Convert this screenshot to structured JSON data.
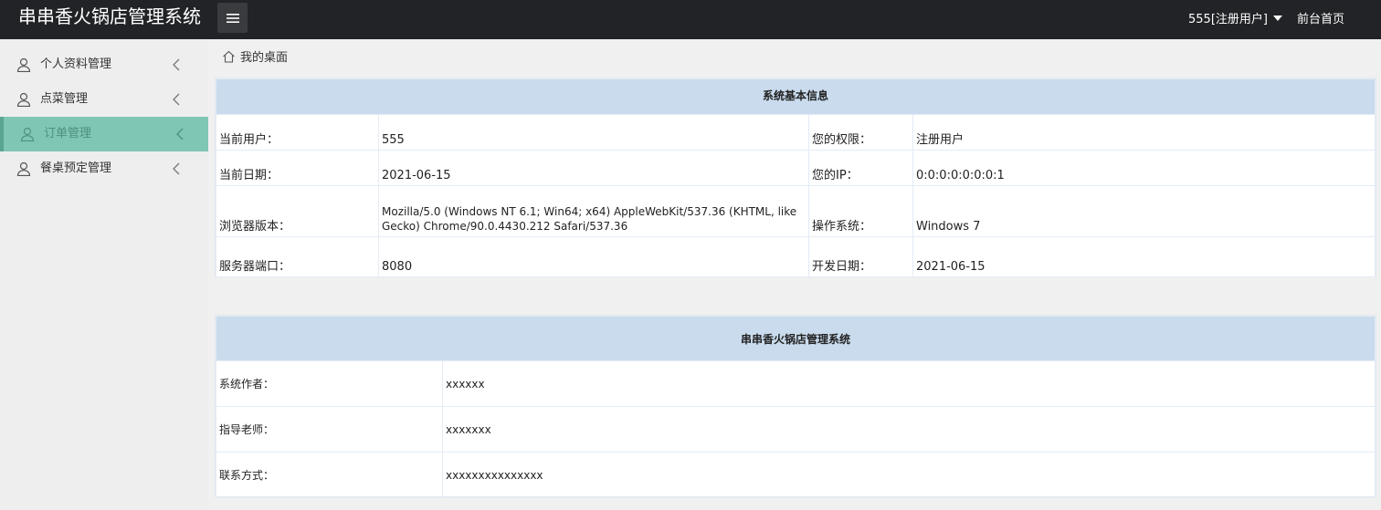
{
  "header": {
    "app_title": "串串香火锅店管理系统",
    "menu_toggle_icon": "hamburger-icon",
    "user_label": "555[注册用户]",
    "home_link": "前台首页"
  },
  "sidebar": {
    "items": [
      {
        "label": "个人资料管理",
        "icon": "user-icon",
        "active": false
      },
      {
        "label": "点菜管理",
        "icon": "user-icon",
        "active": false
      },
      {
        "label": "订单管理",
        "icon": "user-icon",
        "active": true
      },
      {
        "label": "餐桌预定管理",
        "icon": "user-icon",
        "active": false
      }
    ]
  },
  "breadcrumb": {
    "icon": "home-icon",
    "label": "我的桌面"
  },
  "system_info": {
    "title": "系统基本信息",
    "rows": [
      {
        "l1": "当前用户：",
        "v1": "555",
        "l2": "您的权限：",
        "v2": "注册用户"
      },
      {
        "l1": "当前日期：",
        "v1": "2021-06-15",
        "l2": "您的IP：",
        "v2": "0:0:0:0:0:0:0:1"
      },
      {
        "l1": "浏览器版本：",
        "v1": "Mozilla/5.0 (Windows NT 6.1; Win64; x64) AppleWebKit/537.36 (KHTML, like Gecko) Chrome/90.0.4430.212 Safari/537.36",
        "l2": "操作系统：",
        "v2": "Windows 7"
      },
      {
        "l1": "服务器端口：",
        "v1": "8080",
        "l2": "开发日期：",
        "v2": "2021-06-15"
      }
    ]
  },
  "about": {
    "title": "串串香火锅店管理系统",
    "rows": [
      {
        "label": "系统作者：",
        "value": "xxxxxx"
      },
      {
        "label": "指导老师：",
        "value": "xxxxxxx"
      },
      {
        "label": "联系方式：",
        "value": "xxxxxxxxxxxxxxx"
      }
    ]
  },
  "colors": {
    "topbar": "#222326",
    "active_menu": "#7fc6b5",
    "panel_header": "#c9dbed"
  }
}
